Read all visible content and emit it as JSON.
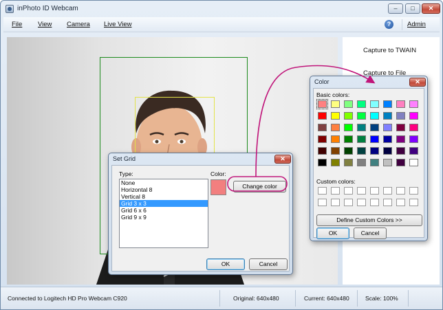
{
  "window": {
    "title": "inPhoto ID Webcam",
    "min_glyph": "–",
    "max_glyph": "□",
    "close_glyph": "✕"
  },
  "menu": {
    "items": [
      "File",
      "View",
      "Camera",
      "Live View"
    ],
    "help_glyph": "?",
    "admin": "Admin"
  },
  "right_panel": {
    "links": [
      "Capture to TWAIN",
      "Capture to File"
    ]
  },
  "status": {
    "connection": "Connected to Logitech HD Pro Webcam C920",
    "original": "Original: 640x480",
    "current": "Current: 640x480",
    "scale": "Scale: 100%"
  },
  "set_grid": {
    "title": "Set Grid",
    "type_label": "Type:",
    "options": [
      "None",
      "Horizontal 8",
      "Vertical 8",
      "Grid 3 x 3",
      "Grid 6 x 6",
      "Grid 9 x 9"
    ],
    "selected_index": 3,
    "color_label": "Color:",
    "current_color": "#f27f7f",
    "change_color": "Change color",
    "ok": "OK",
    "cancel": "Cancel"
  },
  "color_dialog": {
    "title": "Color",
    "basic_label": "Basic colors:",
    "custom_label": "Custom colors:",
    "define_button": "Define Custom Colors >>",
    "ok": "OK",
    "cancel": "Cancel",
    "selected_index": 0,
    "basic_colors": [
      "#ff8080",
      "#ffff80",
      "#80ff80",
      "#00ff80",
      "#80ffff",
      "#0080ff",
      "#ff80c0",
      "#ff80ff",
      "#ff0000",
      "#ffff00",
      "#80ff00",
      "#00ff40",
      "#00ffff",
      "#0080c0",
      "#8080c0",
      "#ff00ff",
      "#804040",
      "#ff8040",
      "#00ff00",
      "#008080",
      "#004080",
      "#8080ff",
      "#800040",
      "#ff0080",
      "#800000",
      "#ff8000",
      "#008000",
      "#008040",
      "#0000ff",
      "#0000a0",
      "#800080",
      "#8000ff",
      "#400000",
      "#804000",
      "#004000",
      "#004040",
      "#000080",
      "#000040",
      "#400040",
      "#400080",
      "#000000",
      "#808000",
      "#808040",
      "#808080",
      "#408080",
      "#c0c0c0",
      "#400040",
      "#ffffff"
    ]
  },
  "accent": {
    "callout": "#c0157a",
    "crop": "#1a8a1a",
    "face": "#e3e34a"
  }
}
